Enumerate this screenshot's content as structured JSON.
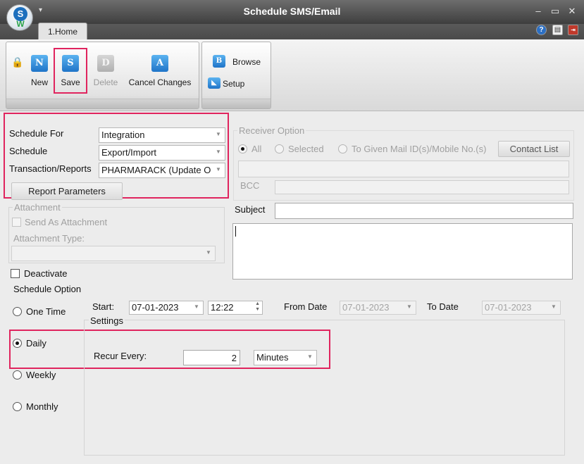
{
  "window": {
    "title": "Schedule SMS/Email",
    "logo_letter": "S",
    "logo_mark": "W",
    "buttons": {
      "minimize": "–",
      "maximize": "▭",
      "close": "✕"
    }
  },
  "tabs": [
    {
      "label": "1.Home"
    }
  ],
  "ribbon": {
    "new": {
      "label": "New",
      "icon": "N"
    },
    "save": {
      "label": "Save",
      "icon": "S"
    },
    "delete": {
      "label": "Delete",
      "icon": "D"
    },
    "cancel": {
      "label": "Cancel Changes",
      "icon": "A"
    },
    "browse": {
      "label": "Browse",
      "icon": "B"
    },
    "setup": {
      "label": "Setup"
    }
  },
  "schedule_for": {
    "label": "Schedule For",
    "value": "Integration"
  },
  "schedule": {
    "label": "Schedule",
    "value": "Export/Import"
  },
  "transaction": {
    "label": "Transaction/Reports",
    "value": "PHARMARACK (Update O"
  },
  "report_parameters": {
    "label": "Report Parameters"
  },
  "attachment": {
    "group_label": "Attachment",
    "send_as_label": "Send As Attachment",
    "type_label": "Attachment Type:",
    "type_value": ""
  },
  "deactivate": {
    "label": "Deactivate"
  },
  "receiver": {
    "group_label": "Receiver Option",
    "all_label": "All",
    "selected_label": "Selected",
    "given_label": "To Given Mail ID(s)/Mobile No.(s)",
    "contact_list_label": "Contact List",
    "bcc_label": "BCC"
  },
  "subject": {
    "label": "Subject",
    "value": ""
  },
  "schedule_option": {
    "label": "Schedule Option",
    "one_time": "One Time",
    "daily": "Daily",
    "weekly": "Weekly",
    "monthly": "Monthly",
    "selected": "Daily"
  },
  "start": {
    "label": "Start:",
    "date": "07-01-2023",
    "time": "12:22"
  },
  "from_date": {
    "label": "From Date",
    "value": "07-01-2023"
  },
  "to_date": {
    "label": "To Date",
    "value": "07-01-2023"
  },
  "settings": {
    "label": "Settings",
    "recur_label": "Recur Every:",
    "recur_value": "2",
    "recur_unit": "Minutes"
  },
  "colors": {
    "highlight": "#e0245e",
    "ribbon_icon": "#1f74c8",
    "titlebar": "#4a4a4a"
  }
}
